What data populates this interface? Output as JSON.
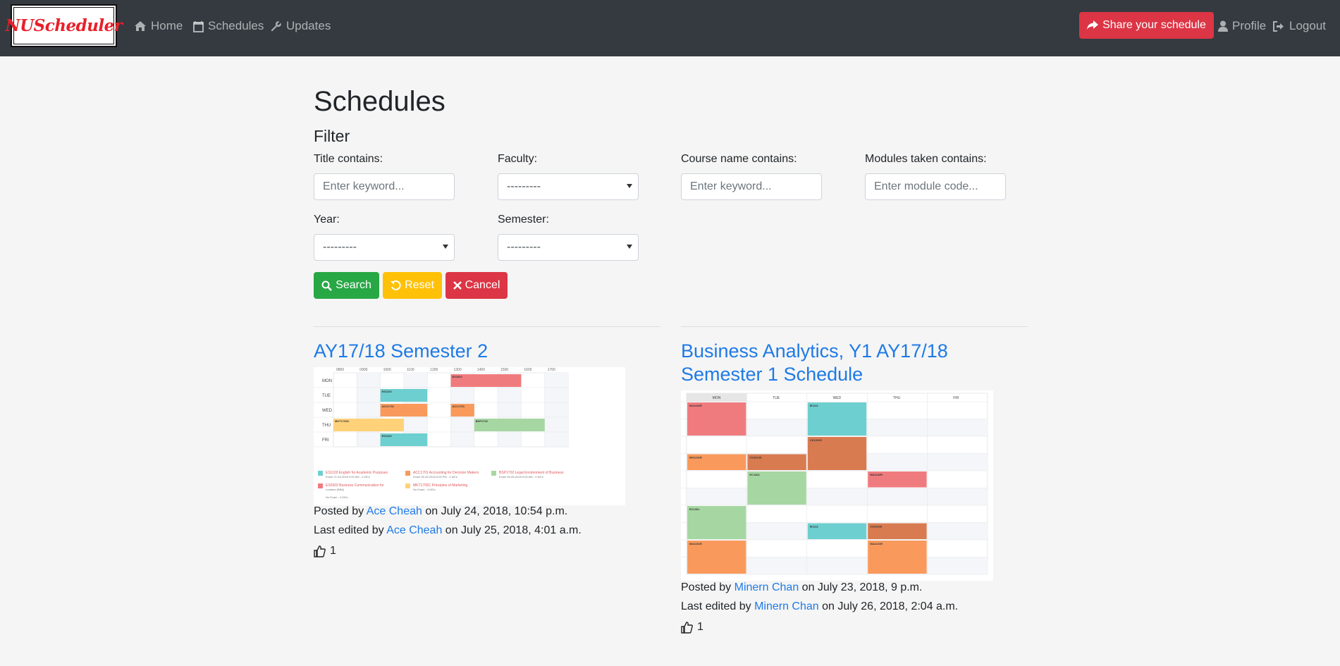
{
  "navbar": {
    "brand": "NUScheduler",
    "links": {
      "home": "Home",
      "schedules": "Schedules",
      "updates": "Updates"
    },
    "share_label": "Share your schedule",
    "profile_label": "Profile",
    "logout_label": "Logout"
  },
  "page": {
    "title": "Schedules",
    "filter_title": "Filter"
  },
  "filters": {
    "title_label": "Title contains:",
    "title_placeholder": "Enter keyword...",
    "faculty_label": "Faculty:",
    "faculty_value": "---------",
    "course_label": "Course name contains:",
    "course_placeholder": "Enter keyword...",
    "modules_label": "Modules taken contains:",
    "modules_placeholder": "Enter module code...",
    "year_label": "Year:",
    "year_value": "---------",
    "semester_label": "Semester:",
    "semester_value": "---------"
  },
  "buttons": {
    "search": "Search",
    "reset": "Reset",
    "cancel": "Cancel"
  },
  "schedules": [
    {
      "title": "AY17/18 Semester 2",
      "posted_prefix": "Posted by ",
      "posted_by": "Ace Cheah",
      "posted_on": " on July 24, 2018, 10:54 p.m.",
      "edited_prefix": "Last edited by ",
      "edited_by": "Ace Cheah",
      "edited_on": " on July 25, 2018, 4:01 a.m.",
      "likes": "1"
    },
    {
      "title_line1": "Business Analytics, Y1 AY17/18",
      "title_line2": "Semester 1 Schedule",
      "posted_prefix": "Posted by ",
      "posted_by": "Minern Chan",
      "posted_on": " on July 23, 2018, 9 p.m.",
      "edited_prefix": "Last edited by ",
      "edited_by": "Minern Chan",
      "edited_on": " on July 26, 2018, 2:04 a.m.",
      "likes": "1"
    }
  ],
  "timetable1": {
    "times": [
      "0800",
      "0900",
      "1000",
      "1100",
      "1200",
      "1300",
      "1400",
      "1500",
      "1600",
      "1700"
    ],
    "days": [
      "MON",
      "TUE",
      "WED",
      "THU",
      "FRI"
    ],
    "blocks": [
      {
        "label": "ES2002",
        "color": "#f07b7e"
      },
      {
        "label": "ES1103",
        "color": "#6dcfcf"
      },
      {
        "label": "ACC1701",
        "color": "#f99a5c"
      },
      {
        "label": "ACC1701",
        "color": "#f99a5c"
      },
      {
        "label": "MKT1705C",
        "color": "#ffd27a"
      },
      {
        "label": "BSP1702",
        "color": "#a6d7a2"
      },
      {
        "label": "ES1103",
        "color": "#6dcfcf"
      }
    ],
    "legend": [
      {
        "name": "ES1103 English for Academic Purposes",
        "sub": "Exam 27-04-2018 9:00 AM - 4 MCs",
        "color": "#6dcfcf"
      },
      {
        "name": "ACC1701 Accounting for Decision Makers",
        "sub": "Exam 05-05-2018 5:00 PM - 4 MCs",
        "color": "#f99a5c"
      },
      {
        "name": "BSP1702 Legal Environment of Business",
        "sub": "Exam 05-05-2018 9:00 AM - 4 MCs",
        "color": "#a6d7a2"
      },
      {
        "name": "ES2002 Business Communication for",
        "sub": "Leaders (BBA)",
        "color": "#f07b7e"
      },
      {
        "name": "MKT1705C Principles of Marketing",
        "sub": "No Exam - 4 MCs",
        "color": "#ffd27a"
      }
    ],
    "legend_extra": "No Exam - 4 MCs"
  },
  "timetable2": {
    "days": [
      "MON",
      "TUE",
      "WED",
      "THU",
      "FRI"
    ],
    "blocks": [
      {
        "label": "MA1102R",
        "color": "#f07b7e"
      },
      {
        "label": "IE1111",
        "color": "#6dcfcf"
      },
      {
        "label": "CS1010S",
        "color": "#d97b50"
      },
      {
        "label": "MA1101R",
        "color": "#f99a5c"
      },
      {
        "label": "CS1010S",
        "color": "#d97b50"
      },
      {
        "label": "EC1301",
        "color": "#a6d7a2"
      },
      {
        "label": "MA1102R",
        "color": "#f07b7e"
      },
      {
        "label": "EC1301",
        "color": "#a6d7a2"
      },
      {
        "label": "IE1111",
        "color": "#6dcfcf"
      },
      {
        "label": "CS1010S",
        "color": "#d97b50"
      },
      {
        "label": "MA1101R",
        "color": "#f99a5c"
      },
      {
        "label": "MA1101R",
        "color": "#f99a5c"
      }
    ]
  }
}
